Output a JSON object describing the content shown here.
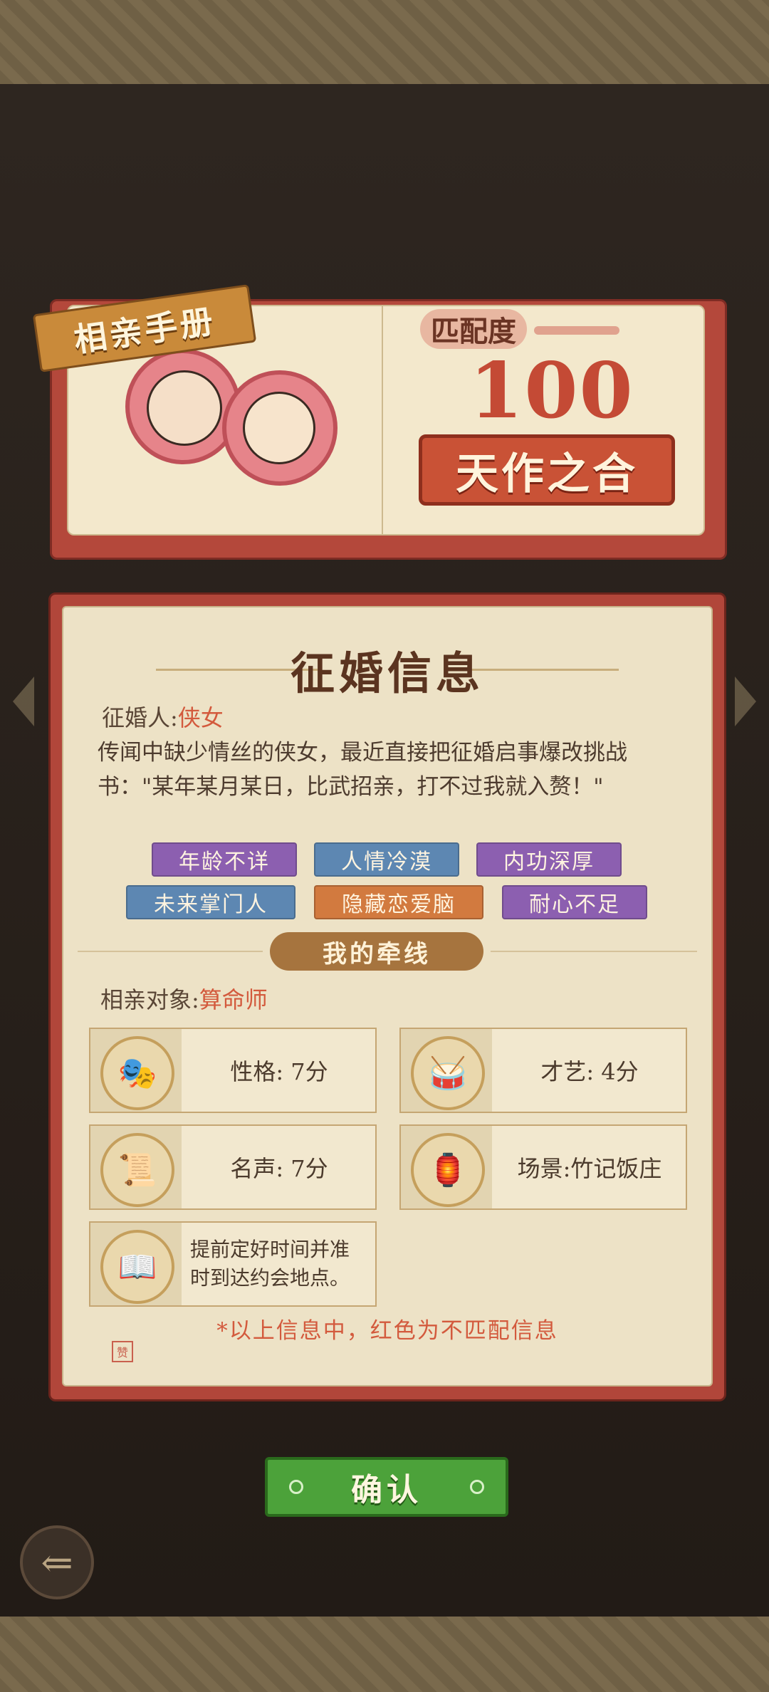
{
  "book": {
    "manual_label": "相亲手册",
    "match_label": "匹配度",
    "match_score": "100",
    "match_verdict": "天作之合"
  },
  "panel": {
    "title": "征婚信息",
    "applicant_label": "征婚人:",
    "applicant_value": "侠女",
    "description": "传闻中缺少情丝的侠女，最近直接把征婚启事爆改挑战书：\"某年某月某日，比武招亲，打不过我就入赘！\"",
    "tags": [
      "年龄不详",
      "人情冷漠",
      "内功深厚",
      "未来掌门人",
      "隐藏恋爱脑",
      "耐心不足"
    ],
    "section_label": "我的牵线",
    "target_label": "相亲对象:",
    "target_value": "算命师",
    "cards": [
      {
        "icon": "mask-icon",
        "text": "性格: 7分"
      },
      {
        "icon": "drum-icon",
        "text": "才艺: 4分"
      },
      {
        "icon": "scroll-icon",
        "text": "名声: 7分"
      },
      {
        "icon": "scene-icon",
        "text": "场景:竹记饭庄"
      },
      {
        "icon": "book-icon",
        "text": "提前定好时间并准时到达约会地点。"
      }
    ],
    "footnote": "*以上信息中，红色为不匹配信息",
    "seal_text": "赞"
  },
  "actions": {
    "confirm_label": "确认"
  },
  "colors": {
    "highlight_red": "#d35a3d",
    "tag_purple": "#8c5fb0",
    "tag_blue": "#5d87b2",
    "tag_orange": "#d27a3f",
    "confirm_green": "#4ca23a"
  }
}
